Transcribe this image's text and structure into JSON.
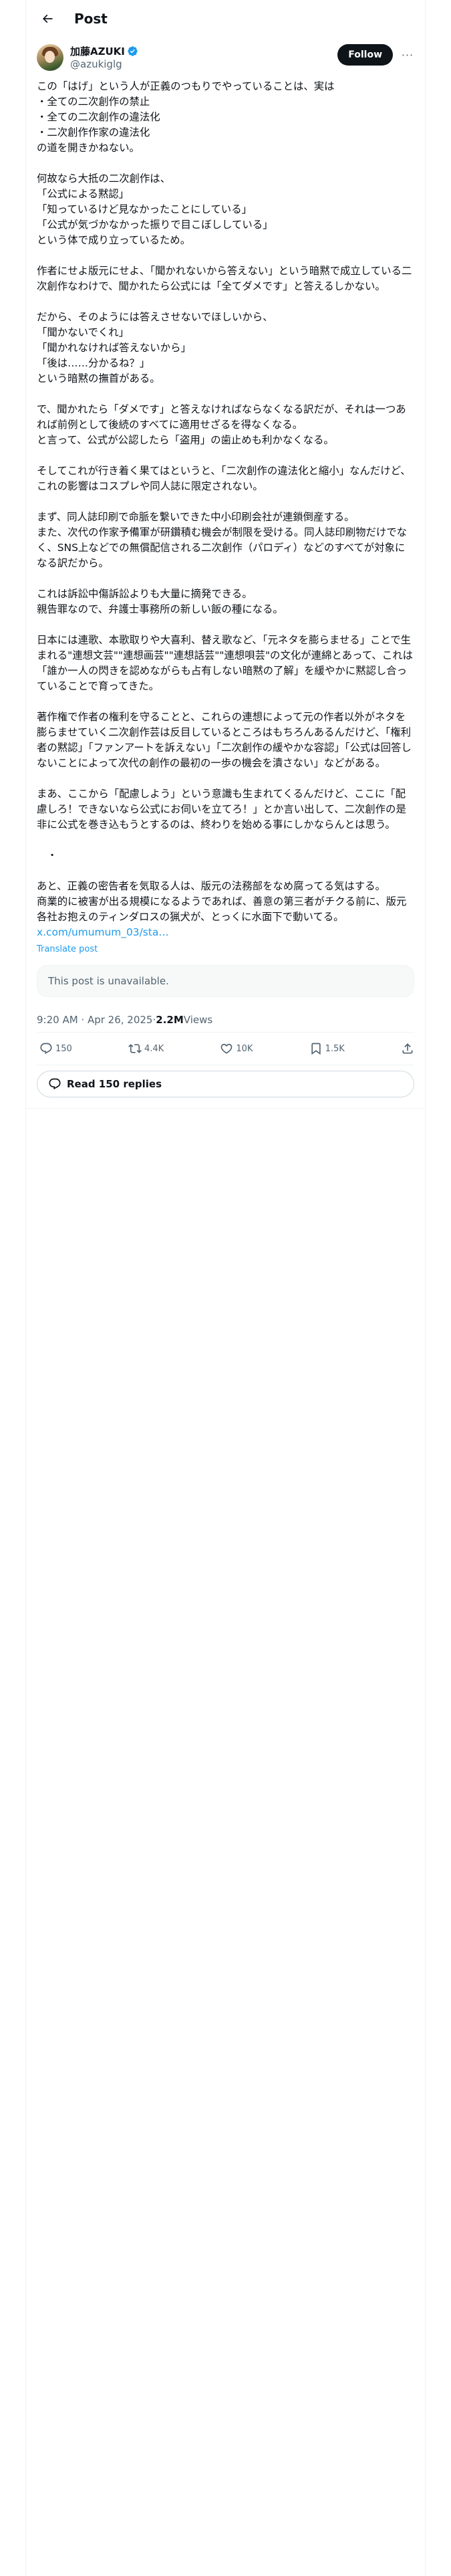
{
  "header": {
    "title": "Post",
    "back_icon": "arrow-left-icon"
  },
  "author": {
    "name": "加藤AZUKI",
    "handle": "@azukiglg",
    "verified_color": "#1d9bf0",
    "follow_label": "Follow",
    "more_label": "···"
  },
  "tweet": {
    "paragraphs": [
      "この「はげ」という人が正義のつもりでやっていることは、実は\n・全ての二次創作の禁止\n・全ての二次創作の違法化\n・二次創作作家の違法化\nの道を開きかねない。",
      "何故なら大抵の二次創作は、\n「公式による黙認」\n「知っているけど見なかったことにしている」\n「公式が気づかなかった振りで目こぼししている」\nという体で成り立っているため。",
      "作者にせよ版元にせよ、「聞かれないから答えない」という暗黙で成立している二次創作なわけで、聞かれたら公式には「全てダメです」と答えるしかない。",
      "だから、そのようには答えさせないでほしいから、\n「聞かないでくれ」\n「聞かれなければ答えないから」\n「後は……分かるね？」\nという暗黙の撫首がある。",
      "で、聞かれたら「ダメです」と答えなければならなくなる訳だが、それは一つあれば前例として後続のすべてに適用せざるを得なくなる。\nと言って、公式が公認したら「盗用」の歯止めも利かなくなる。",
      "そしてこれが行き着く果てはというと、「二次創作の違法化と縮小」なんだけど、これの影響はコスプレや同人誌に限定されない。",
      "まず、同人誌印刷で命脈を繋いできた中小印刷会社が連鎖倒産する。\nまた、次代の作家予備軍が研鑽積む機会が制限を受ける。同人誌印刷物だけでなく、SNS上などでの無償配信される二次創作（パロディ）などのすべてが対象になる訳だから。",
      "これは訴訟中傷訴訟よりも大量に摘発できる。\n親告罪なので、弁護士事務所の新しい飯の種になる。",
      "日本には連歌、本歌取りや大喜利、替え歌など、「元ネタを膨らませる」ことで生まれる\"連想文芸\"\"連想画芸\"\"連想話芸\"\"連想唄芸\"の文化が連綿とあって、これは「誰か一人の閃きを認めながらも占有しない暗黙の了解」を緩やかに黙認し合っていることで育ってきた。",
      "著作権で作者の権利を守ることと、これらの連想によって元の作者以外がネタを膨らませていく二次創作芸は反目しているところはもちろんあるんだけど、「権利者の黙認」「ファンアートを訴えない」「二次創作の緩やかな容認」「公式は回答しないことによって次代の創作の最初の一歩の機会を潰さない」などがある。",
      "まあ、ここから「配慮しよう」という意識も生まれてくるんだけど、ここに「配慮しろ！できないなら公式にお伺いを立てろ！」とか言い出して、二次創作の是非に公式を巻き込もうとするのは、終わりを始める事にしかならんとは思う。",
      "　・",
      "あと、正義の密告者を気取る人は、版元の法務部をなめ腐ってる気はする。\n商業的に被害が出る規模になるようであれば、善意の第三者がチクる前に、版元各社お抱えのティンダロスの猟犬が、とっくに水面下で動いてる。"
    ],
    "link": "x.com/umumum_03/sta…",
    "translate_label": "Translate post"
  },
  "quote": {
    "text": "This post is unavailable."
  },
  "meta": {
    "time": "9:20 AM · Apr 26, 2025",
    "separator": " · ",
    "views_count": "2.2M",
    "views_label": " Views"
  },
  "actions": {
    "replies": "150",
    "reposts": "4.4K",
    "likes": "10K",
    "bookmarks": "1.5K"
  },
  "read_replies_label": "Read 150 replies"
}
